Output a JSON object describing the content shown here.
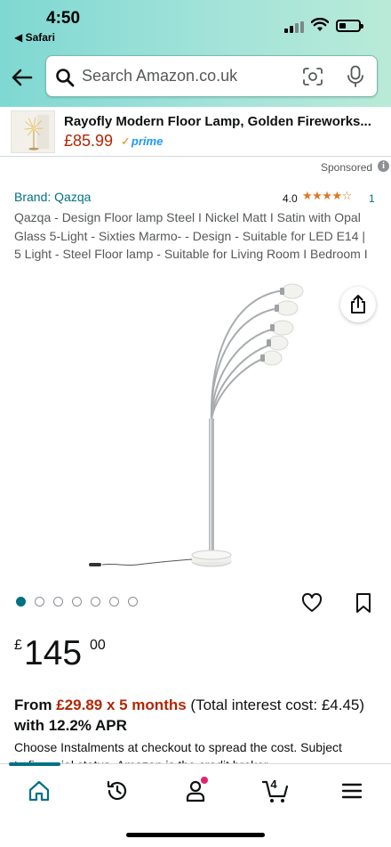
{
  "status_bar": {
    "time": "4:50",
    "back_app": "◀ Safari"
  },
  "search": {
    "placeholder": "Search Amazon.co.uk"
  },
  "ad": {
    "title": "Rayofly Modern Floor Lamp, Golden Fireworks...",
    "price": "£85.99",
    "prime_check": "✓",
    "prime_label": "prime"
  },
  "sponsored": {
    "label": "Sponsored",
    "info_glyph": "i"
  },
  "product": {
    "brand": "Brand: Qazqa",
    "rating": "4.0",
    "rating_value": 4.0,
    "stars": "★★★★☆",
    "rating_count": "1",
    "title": "Qazqa - Design Floor lamp Steel I Nickel Matt I Satin with Opal Glass 5-Light - Sixties Marmo- - Design - Suitable for LED E14 | 5 Light - Steel Floor lamp - Suitable for Living Room I Bedroom I",
    "image_count": 7,
    "active_image": 1
  },
  "price": {
    "currency": "£",
    "whole": "145",
    "fraction": "00"
  },
  "finance": {
    "prefix": "From ",
    "amount": "£29.89 x 5 months",
    "middle": " (Total interest cost: £4.45) ",
    "apr": "with 12.2% APR",
    "note": "Choose Instalments at checkout to spread the cost. Subject",
    "clipped": "to financial status. Amazon is the credit broker."
  },
  "bottom_nav": {
    "cart_count": "4",
    "items": [
      "home-icon",
      "inspire-icon",
      "account-icon",
      "cart-icon",
      "menu-icon"
    ]
  },
  "colors": {
    "accent": "#007185",
    "price_red": "#b12704",
    "star": "#de7921",
    "prime_blue": "#1a98ff",
    "header_gradient_start": "#7fd8d2",
    "header_gradient_end": "#b9ead7"
  }
}
